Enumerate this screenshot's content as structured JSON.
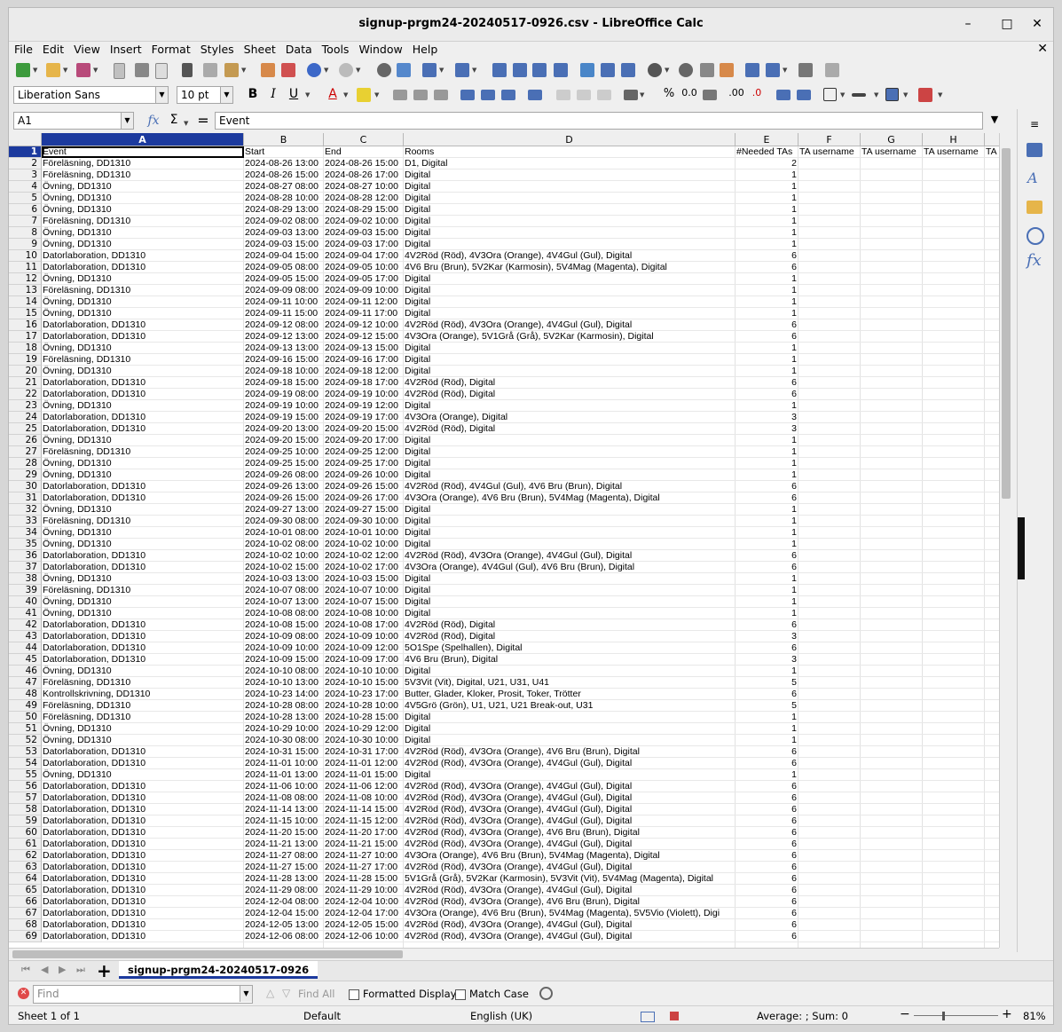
{
  "window": {
    "title": "signup-prgm24-20240517-0926.csv - LibreOffice Calc"
  },
  "menu": [
    "File",
    "Edit",
    "View",
    "Insert",
    "Format",
    "Styles",
    "Sheet",
    "Data",
    "Tools",
    "Window",
    "Help"
  ],
  "toolbar": {
    "font_name": "Liberation Sans",
    "font_size": "10 pt",
    "bold": "B",
    "italic": "I",
    "underline": "U"
  },
  "formula_bar": {
    "cell_ref": "A1",
    "content": "Event"
  },
  "columns": [
    "A",
    "B",
    "C",
    "D",
    "E",
    "F",
    "G",
    "H"
  ],
  "header_row": [
    "Event",
    "Start",
    "End",
    "Rooms",
    "#Needed TAs",
    "TA username",
    "TA username",
    "TA username",
    "TA"
  ],
  "rows": [
    [
      "Föreläsning, DD1310",
      "2024-08-26 13:00",
      "2024-08-26 15:00",
      "D1, Digital",
      "2"
    ],
    [
      "Föreläsning, DD1310",
      "2024-08-26 15:00",
      "2024-08-26 17:00",
      "Digital",
      "1"
    ],
    [
      "Övning, DD1310",
      "2024-08-27 08:00",
      "2024-08-27 10:00",
      "Digital",
      "1"
    ],
    [
      "Övning, DD1310",
      "2024-08-28 10:00",
      "2024-08-28 12:00",
      "Digital",
      "1"
    ],
    [
      "Övning, DD1310",
      "2024-08-29 13:00",
      "2024-08-29 15:00",
      "Digital",
      "1"
    ],
    [
      "Föreläsning, DD1310",
      "2024-09-02 08:00",
      "2024-09-02 10:00",
      "Digital",
      "1"
    ],
    [
      "Övning, DD1310",
      "2024-09-03 13:00",
      "2024-09-03 15:00",
      "Digital",
      "1"
    ],
    [
      "Övning, DD1310",
      "2024-09-03 15:00",
      "2024-09-03 17:00",
      "Digital",
      "1"
    ],
    [
      "Datorlaboration, DD1310",
      "2024-09-04 15:00",
      "2024-09-04 17:00",
      "4V2Röd (Röd), 4V3Ora (Orange), 4V4Gul (Gul), Digital",
      "6"
    ],
    [
      "Datorlaboration, DD1310",
      "2024-09-05 08:00",
      "2024-09-05 10:00",
      "4V6 Bru (Brun), 5V2Kar (Karmosin), 5V4Mag (Magenta), Digital",
      "6"
    ],
    [
      "Övning, DD1310",
      "2024-09-05 15:00",
      "2024-09-05 17:00",
      "Digital",
      "1"
    ],
    [
      "Föreläsning, DD1310",
      "2024-09-09 08:00",
      "2024-09-09 10:00",
      "Digital",
      "1"
    ],
    [
      "Övning, DD1310",
      "2024-09-11 10:00",
      "2024-09-11 12:00",
      "Digital",
      "1"
    ],
    [
      "Övning, DD1310",
      "2024-09-11 15:00",
      "2024-09-11 17:00",
      "Digital",
      "1"
    ],
    [
      "Datorlaboration, DD1310",
      "2024-09-12 08:00",
      "2024-09-12 10:00",
      "4V2Röd (Röd), 4V3Ora (Orange), 4V4Gul (Gul), Digital",
      "6"
    ],
    [
      "Datorlaboration, DD1310",
      "2024-09-12 13:00",
      "2024-09-12 15:00",
      "4V3Ora (Orange), 5V1Grå (Grå), 5V2Kar (Karmosin), Digital",
      "6"
    ],
    [
      "Övning, DD1310",
      "2024-09-13 13:00",
      "2024-09-13 15:00",
      "Digital",
      "1"
    ],
    [
      "Föreläsning, DD1310",
      "2024-09-16 15:00",
      "2024-09-16 17:00",
      "Digital",
      "1"
    ],
    [
      "Övning, DD1310",
      "2024-09-18 10:00",
      "2024-09-18 12:00",
      "Digital",
      "1"
    ],
    [
      "Datorlaboration, DD1310",
      "2024-09-18 15:00",
      "2024-09-18 17:00",
      "4V2Röd (Röd), Digital",
      "6"
    ],
    [
      "Datorlaboration, DD1310",
      "2024-09-19 08:00",
      "2024-09-19 10:00",
      "4V2Röd (Röd), Digital",
      "6"
    ],
    [
      "Övning, DD1310",
      "2024-09-19 10:00",
      "2024-09-19 12:00",
      "Digital",
      "1"
    ],
    [
      "Datorlaboration, DD1310",
      "2024-09-19 15:00",
      "2024-09-19 17:00",
      "4V3Ora (Orange), Digital",
      "3"
    ],
    [
      "Datorlaboration, DD1310",
      "2024-09-20 13:00",
      "2024-09-20 15:00",
      "4V2Röd (Röd), Digital",
      "3"
    ],
    [
      "Övning, DD1310",
      "2024-09-20 15:00",
      "2024-09-20 17:00",
      "Digital",
      "1"
    ],
    [
      "Föreläsning, DD1310",
      "2024-09-25 10:00",
      "2024-09-25 12:00",
      "Digital",
      "1"
    ],
    [
      "Övning, DD1310",
      "2024-09-25 15:00",
      "2024-09-25 17:00",
      "Digital",
      "1"
    ],
    [
      "Övning, DD1310",
      "2024-09-26 08:00",
      "2024-09-26 10:00",
      "Digital",
      "1"
    ],
    [
      "Datorlaboration, DD1310",
      "2024-09-26 13:00",
      "2024-09-26 15:00",
      "4V2Röd (Röd), 4V4Gul (Gul), 4V6 Bru (Brun), Digital",
      "6"
    ],
    [
      "Datorlaboration, DD1310",
      "2024-09-26 15:00",
      "2024-09-26 17:00",
      "4V3Ora (Orange), 4V6 Bru (Brun), 5V4Mag (Magenta), Digital",
      "6"
    ],
    [
      "Övning, DD1310",
      "2024-09-27 13:00",
      "2024-09-27 15:00",
      "Digital",
      "1"
    ],
    [
      "Föreläsning, DD1310",
      "2024-09-30 08:00",
      "2024-09-30 10:00",
      "Digital",
      "1"
    ],
    [
      "Övning, DD1310",
      "2024-10-01 08:00",
      "2024-10-01 10:00",
      "Digital",
      "1"
    ],
    [
      "Övning, DD1310",
      "2024-10-02 08:00",
      "2024-10-02 10:00",
      "Digital",
      "1"
    ],
    [
      "Datorlaboration, DD1310",
      "2024-10-02 10:00",
      "2024-10-02 12:00",
      "4V2Röd (Röd), 4V3Ora (Orange), 4V4Gul (Gul), Digital",
      "6"
    ],
    [
      "Datorlaboration, DD1310",
      "2024-10-02 15:00",
      "2024-10-02 17:00",
      "4V3Ora (Orange), 4V4Gul (Gul), 4V6 Bru (Brun), Digital",
      "6"
    ],
    [
      "Övning, DD1310",
      "2024-10-03 13:00",
      "2024-10-03 15:00",
      "Digital",
      "1"
    ],
    [
      "Föreläsning, DD1310",
      "2024-10-07 08:00",
      "2024-10-07 10:00",
      "Digital",
      "1"
    ],
    [
      "Övning, DD1310",
      "2024-10-07 13:00",
      "2024-10-07 15:00",
      "Digital",
      "1"
    ],
    [
      "Övning, DD1310",
      "2024-10-08 08:00",
      "2024-10-08 10:00",
      "Digital",
      "1"
    ],
    [
      "Datorlaboration, DD1310",
      "2024-10-08 15:00",
      "2024-10-08 17:00",
      "4V2Röd (Röd), Digital",
      "6"
    ],
    [
      "Datorlaboration, DD1310",
      "2024-10-09 08:00",
      "2024-10-09 10:00",
      "4V2Röd (Röd), Digital",
      "3"
    ],
    [
      "Datorlaboration, DD1310",
      "2024-10-09 10:00",
      "2024-10-09 12:00",
      "5O1Spe (Spelhallen), Digital",
      "6"
    ],
    [
      "Datorlaboration, DD1310",
      "2024-10-09 15:00",
      "2024-10-09 17:00",
      "4V6 Bru (Brun), Digital",
      "3"
    ],
    [
      "Övning, DD1310",
      "2024-10-10 08:00",
      "2024-10-10 10:00",
      "Digital",
      "1"
    ],
    [
      "Föreläsning, DD1310",
      "2024-10-10 13:00",
      "2024-10-10 15:00",
      "5V3Vit (Vit), Digital, U21, U31, U41",
      "5"
    ],
    [
      "Kontrollskrivning, DD1310",
      "2024-10-23 14:00",
      "2024-10-23 17:00",
      "Butter, Glader, Kloker, Prosit, Toker, Trötter",
      "6"
    ],
    [
      "Föreläsning, DD1310",
      "2024-10-28 08:00",
      "2024-10-28 10:00",
      "4V5Grö (Grön), U1, U21, U21 Break-out, U31",
      "5"
    ],
    [
      "Föreläsning, DD1310",
      "2024-10-28 13:00",
      "2024-10-28 15:00",
      "Digital",
      "1"
    ],
    [
      "Övning, DD1310",
      "2024-10-29 10:00",
      "2024-10-29 12:00",
      "Digital",
      "1"
    ],
    [
      "Övning, DD1310",
      "2024-10-30 08:00",
      "2024-10-30 10:00",
      "Digital",
      "1"
    ],
    [
      "Datorlaboration, DD1310",
      "2024-10-31 15:00",
      "2024-10-31 17:00",
      "4V2Röd (Röd), 4V3Ora (Orange), 4V6 Bru (Brun), Digital",
      "6"
    ],
    [
      "Datorlaboration, DD1310",
      "2024-11-01 10:00",
      "2024-11-01 12:00",
      "4V2Röd (Röd), 4V3Ora (Orange), 4V4Gul (Gul), Digital",
      "6"
    ],
    [
      "Övning, DD1310",
      "2024-11-01 13:00",
      "2024-11-01 15:00",
      "Digital",
      "1"
    ],
    [
      "Datorlaboration, DD1310",
      "2024-11-06 10:00",
      "2024-11-06 12:00",
      "4V2Röd (Röd), 4V3Ora (Orange), 4V4Gul (Gul), Digital",
      "6"
    ],
    [
      "Datorlaboration, DD1310",
      "2024-11-08 08:00",
      "2024-11-08 10:00",
      "4V2Röd (Röd), 4V3Ora (Orange), 4V4Gul (Gul), Digital",
      "6"
    ],
    [
      "Datorlaboration, DD1310",
      "2024-11-14 13:00",
      "2024-11-14 15:00",
      "4V2Röd (Röd), 4V3Ora (Orange), 4V4Gul (Gul), Digital",
      "6"
    ],
    [
      "Datorlaboration, DD1310",
      "2024-11-15 10:00",
      "2024-11-15 12:00",
      "4V2Röd (Röd), 4V3Ora (Orange), 4V4Gul (Gul), Digital",
      "6"
    ],
    [
      "Datorlaboration, DD1310",
      "2024-11-20 15:00",
      "2024-11-20 17:00",
      "4V2Röd (Röd), 4V3Ora (Orange), 4V6 Bru (Brun), Digital",
      "6"
    ],
    [
      "Datorlaboration, DD1310",
      "2024-11-21 13:00",
      "2024-11-21 15:00",
      "4V2Röd (Röd), 4V3Ora (Orange), 4V4Gul (Gul), Digital",
      "6"
    ],
    [
      "Datorlaboration, DD1310",
      "2024-11-27 08:00",
      "2024-11-27 10:00",
      "4V3Ora (Orange), 4V6 Bru (Brun), 5V4Mag (Magenta), Digital",
      "6"
    ],
    [
      "Datorlaboration, DD1310",
      "2024-11-27 15:00",
      "2024-11-27 17:00",
      "4V2Röd (Röd), 4V3Ora (Orange), 4V4Gul (Gul), Digital",
      "6"
    ],
    [
      "Datorlaboration, DD1310",
      "2024-11-28 13:00",
      "2024-11-28 15:00",
      "5V1Grå (Grå), 5V2Kar (Karmosin), 5V3Vit (Vit), 5V4Mag (Magenta), Digital",
      "6"
    ],
    [
      "Datorlaboration, DD1310",
      "2024-11-29 08:00",
      "2024-11-29 10:00",
      "4V2Röd (Röd), 4V3Ora (Orange), 4V4Gul (Gul), Digital",
      "6"
    ],
    [
      "Datorlaboration, DD1310",
      "2024-12-04 08:00",
      "2024-12-04 10:00",
      "4V2Röd (Röd), 4V3Ora (Orange), 4V6 Bru (Brun), Digital",
      "6"
    ],
    [
      "Datorlaboration, DD1310",
      "2024-12-04 15:00",
      "2024-12-04 17:00",
      "4V3Ora (Orange), 4V6 Bru (Brun), 5V4Mag (Magenta), 5V5Vio (Violett), Digi",
      "6"
    ],
    [
      "Datorlaboration, DD1310",
      "2024-12-05 13:00",
      "2024-12-05 15:00",
      "4V2Röd (Röd), 4V3Ora (Orange), 4V4Gul (Gul), Digital",
      "6"
    ],
    [
      "Datorlaboration, DD1310",
      "2024-12-06 08:00",
      "2024-12-06 10:00",
      "4V2Röd (Röd), 4V3Ora (Orange), 4V4Gul (Gul), Digital",
      "6"
    ]
  ],
  "sheet_tab": "signup-prgm24-20240517-0926",
  "find_bar": {
    "placeholder": "Find",
    "find_all": "Find All",
    "formatted_display": "Formatted Display",
    "match_case": "Match Case"
  },
  "status": {
    "sheet": "Sheet 1 of 1",
    "style": "Default",
    "language": "English (UK)",
    "summary": "Average: ; Sum: 0",
    "zoom": "81%"
  },
  "colors": {
    "selection": "#1c3a9e",
    "spellcheck": "#e33"
  }
}
